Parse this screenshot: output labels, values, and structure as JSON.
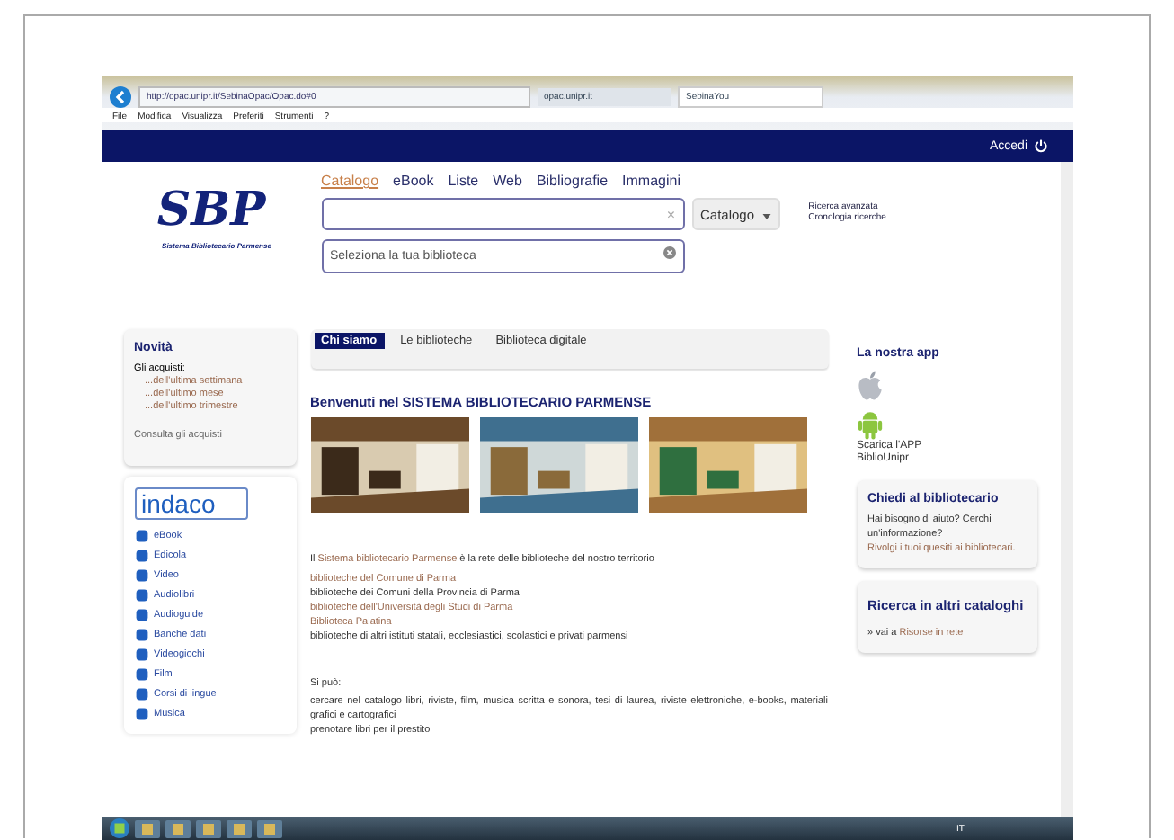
{
  "browser": {
    "url": "http://opac.unipr.it/SebinaOpac/Opac.do#0",
    "tabs": [
      {
        "label": "opac.unipr.it",
        "selected": false
      },
      {
        "label": "SebinaYou",
        "selected": true
      }
    ],
    "menu": [
      "File",
      "Modifica",
      "Visualizza",
      "Preferiti",
      "Strumenti",
      "?"
    ]
  },
  "header": {
    "login": "Accedi",
    "logo_letters": "SBP",
    "logo_caption": "Sistema Bibliotecario Parmense"
  },
  "search": {
    "tabs": [
      {
        "label": "Catalogo",
        "selected": true
      },
      {
        "label": "eBook",
        "selected": false
      },
      {
        "label": "Liste",
        "selected": false
      },
      {
        "label": "Web",
        "selected": false
      },
      {
        "label": "Bibliografie",
        "selected": false
      },
      {
        "label": "Immagini",
        "selected": false
      }
    ],
    "clear": "×",
    "scope": "Catalogo",
    "library_placeholder": "Seleziona la tua biblioteca",
    "links": [
      "Ricerca avanzata",
      "Cronologia ricerche"
    ]
  },
  "news": {
    "title": "Novità",
    "intro": "Gli acquisti:",
    "links": [
      "...dell'ultima settimana",
      "...dell'ultimo mese",
      "...dell'ultimo trimestre"
    ],
    "more": "Consulta gli acquisti"
  },
  "indaco": {
    "logo": "indaco",
    "items": [
      "eBook",
      "Edicola",
      "Video",
      "Audiolibri",
      "Audioguide",
      "Banche dati",
      "Videogiochi",
      "Film",
      "Corsi di lingue",
      "Musica"
    ]
  },
  "content": {
    "tabs": [
      {
        "label": "Chi siamo",
        "selected": true
      },
      {
        "label": "Le biblioteche",
        "selected": false
      },
      {
        "label": "Biblioteca digitale",
        "selected": false
      }
    ],
    "heading": "Benvenuti nel SISTEMA BIBLIOTECARIO PARMENSE",
    "pictures": [
      {
        "kind": "picture"
      },
      {
        "kind": "picture"
      },
      {
        "kind": "picture"
      }
    ],
    "intro": {
      "before": "Il ",
      "link": "Sistema bibliotecario Parmense",
      "after": " è la rete delle biblioteche del nostro territorio"
    },
    "lines": [
      {
        "kind": "link",
        "text": "biblioteche del Comune di Parma"
      },
      {
        "kind": "text",
        "text": "biblioteche dei Comuni della Provincia di Parma"
      },
      {
        "kind": "link",
        "text": "biblioteche dell'Università degli Studi di Parma"
      },
      {
        "kind": "link",
        "text": "Biblioteca Palatina"
      },
      {
        "kind": "text",
        "text": "biblioteche di altri istituti statali, ecclesiastici, scolastici e privati parmensi"
      }
    ],
    "can_title": "Si può:",
    "can": [
      "cercare nel catalogo libri, riviste, film, musica scritta e sonora, tesi di laurea, riviste elettroniche, e-books, materiali grafici e cartografici",
      "prenotare libri per il prestito"
    ]
  },
  "right": {
    "app_title": "La nostra app",
    "app_text": "Scarica l'APP BiblioUnipr",
    "ask": {
      "title": "Chiedi al bibliotecario",
      "text": "Hai bisogno di aiuto? Cerchi un'informazione?",
      "link": "Rivolgi i tuoi quesiti ai bibliotecari."
    },
    "other": {
      "title": "Ricerca in altri cataloghi",
      "prefix": "» vai a ",
      "link": "Risorse in rete"
    }
  },
  "taskbar": {
    "language": "IT"
  }
}
